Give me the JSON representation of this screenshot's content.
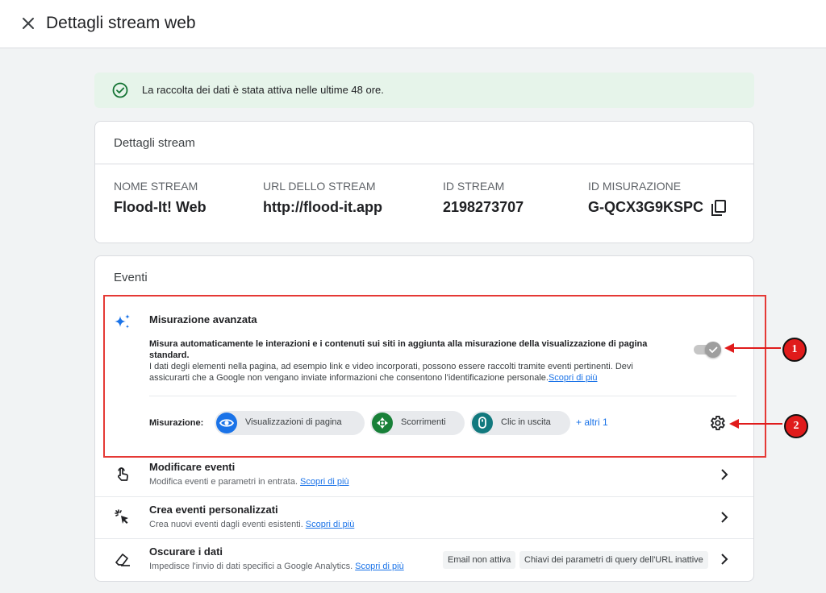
{
  "header": {
    "title": "Dettagli stream web"
  },
  "banner": {
    "text": "La raccolta dei dati è stata attiva nelle ultime 48 ore."
  },
  "stream_details": {
    "title": "Dettagli stream",
    "fields": [
      {
        "label": "NOME STREAM",
        "value": "Flood-It! Web"
      },
      {
        "label": "URL DELLO STREAM",
        "value": "http://flood-it.app"
      },
      {
        "label": "ID STREAM",
        "value": "2198273707"
      },
      {
        "label": "ID MISURAZIONE",
        "value": "G-QCX3G9KSPC"
      }
    ]
  },
  "events": {
    "title": "Eventi",
    "enhanced_measurement": {
      "title": "Misurazione avanzata",
      "desc_bold": "Misura automaticamente le interazioni e i contenuti sui siti in aggiunta alla misurazione della visualizzazione di pagina standard.",
      "desc": "I dati degli elementi nella pagina, ad esempio link e video incorporati, possono essere raccolti tramite eventi pertinenti. Devi assicurarti che a Google non vengano inviate informazioni che consentono l'identificazione personale.",
      "learn_more": "Scopri di più",
      "toggle_on": true,
      "measurement_label": "Misurazione:",
      "chips": [
        {
          "label": "Visualizzazioni di pagina",
          "icon": "eye-icon",
          "color": "#1a73e8"
        },
        {
          "label": "Scorrimenti",
          "icon": "scroll-icon",
          "color": "#188038"
        },
        {
          "label": "Clic in uscita",
          "icon": "mouse-icon",
          "color": "#12797e"
        }
      ],
      "more": "+ altri 1"
    },
    "rows": [
      {
        "title": "Modificare eventi",
        "subtitle": "Modifica eventi e parametri in entrata.",
        "link": "Scopri di più",
        "icon": "touch-icon"
      },
      {
        "title": "Crea eventi personalizzati",
        "subtitle": "Crea nuovi eventi dagli eventi esistenti.",
        "link": "Scopri di più",
        "icon": "click-sparkle-icon"
      },
      {
        "title": "Oscurare i dati",
        "subtitle": "Impedisce l'invio di dati specifici a Google Analytics.",
        "link": "Scopri di più",
        "icon": "eraser-icon",
        "pills": [
          "Email non attiva",
          "Chiavi dei parametri di query dell'URL inattive"
        ]
      }
    ]
  },
  "annotations": {
    "badge1": "1",
    "badge2": "2",
    "highlight_color": "#e53935"
  }
}
